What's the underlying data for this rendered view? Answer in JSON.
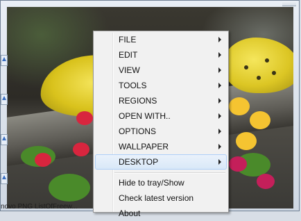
{
  "menu": {
    "items": [
      {
        "label": "FILE",
        "submenu": true
      },
      {
        "label": "EDIT",
        "submenu": true
      },
      {
        "label": "VIEW",
        "submenu": true
      },
      {
        "label": "TOOLS",
        "submenu": true
      },
      {
        "label": "REGIONS",
        "submenu": true
      },
      {
        "label": "OPEN WITH..",
        "submenu": true
      },
      {
        "label": "OPTIONS",
        "submenu": true
      },
      {
        "label": "WALLPAPER",
        "submenu": true
      },
      {
        "label": "DESKTOP",
        "submenu": true,
        "highlighted": true
      }
    ],
    "bottom_items": [
      {
        "label": "Hide to tray/Show"
      },
      {
        "label": "Check latest version"
      },
      {
        "label": "About"
      }
    ]
  },
  "taskbar": {
    "text": "novo PNG  ListOfFreew..."
  },
  "colors": {
    "menu_bg": "#f1f1f1",
    "highlight": "#d9e8f8",
    "highlight_border": "#aecff7"
  }
}
